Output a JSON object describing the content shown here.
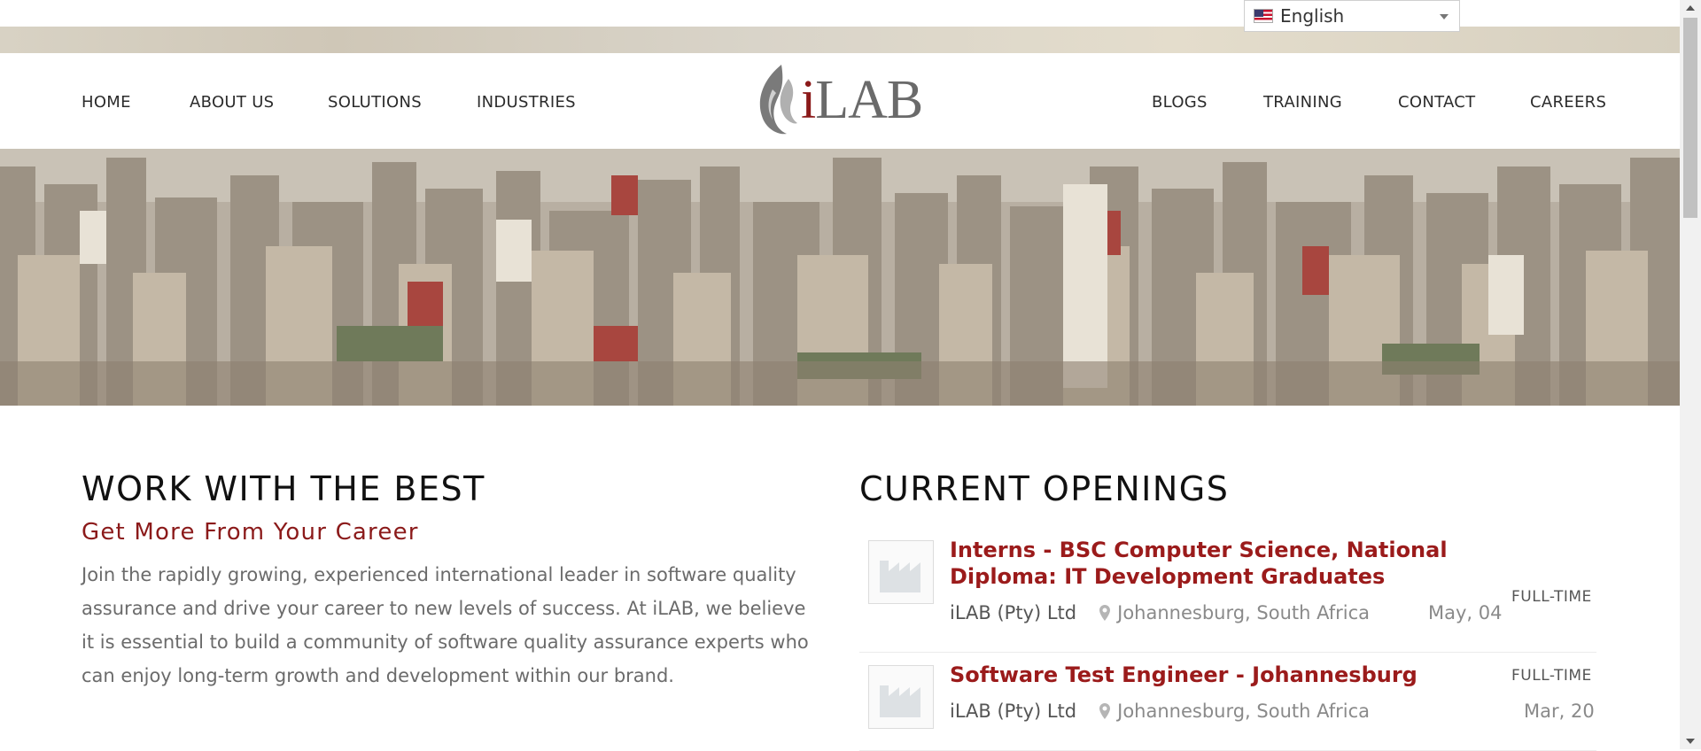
{
  "language_selector": {
    "value": "English",
    "flag_icon": "us-flag-icon"
  },
  "nav": {
    "left": [
      "HOME",
      "ABOUT US",
      "SOLUTIONS",
      "INDUSTRIES"
    ],
    "right": [
      "BLOGS",
      "TRAINING",
      "CONTACT",
      "CAREERS"
    ]
  },
  "logo": {
    "text_i": "i",
    "text_rest": "LAB"
  },
  "intro": {
    "heading": "WORK WITH THE BEST",
    "subheading": "Get More From Your Career",
    "body": "Join the rapidly growing, experienced international leader in software quality assurance and drive your career to new levels of success.  At iLAB, we believe it is essential to build a community of software quality assurance experts who can enjoy long-term growth and development within our brand."
  },
  "openings": {
    "heading": "CURRENT OPENINGS",
    "jobs": [
      {
        "title": "Interns - BSC Computer Science, National Diploma: IT Development Graduates",
        "company": "iLAB (Pty) Ltd",
        "location": "Johannesburg, South Africa",
        "date": "May, 04",
        "type": "FULL-TIME"
      },
      {
        "title": "Software Test Engineer - Johannesburg",
        "company": "iLAB (Pty) Ltd",
        "location": "Johannesburg, South Africa",
        "date": "Mar, 20",
        "type": "FULL-TIME"
      }
    ]
  },
  "colors": {
    "brand_red": "#8b1a1a",
    "link_red": "#9b1b1b",
    "text_grey": "#6b6b6b"
  }
}
